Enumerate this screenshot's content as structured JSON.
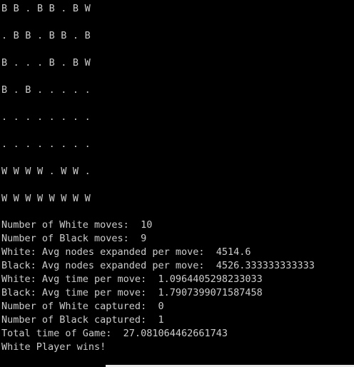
{
  "board": {
    "rows": [
      "B B . B B . B W",
      ". B B . B B . B",
      "B . . . B . B W",
      "B . B . . . . .",
      ". . . . . . . .",
      ". . . . . . . .",
      "W W W W . W W .",
      "W W W W W W W W"
    ]
  },
  "stats": {
    "lines": [
      "Number of White moves:  10",
      "Number of Black moves:  9",
      "White: Avg nodes expanded per move:  4514.6",
      "Black: Avg nodes expanded per move:  4526.333333333333",
      "White: Avg time per move:  1.0964405298233033",
      "Black: Avg time per move:  1.7907399071587458",
      "Number of White captured:  0",
      "Number of Black captured:  1",
      "Total time of Game:  27.081064462661743",
      "White Player wins!"
    ]
  },
  "colors": {
    "background": "#000000",
    "text": "#cccccc"
  }
}
